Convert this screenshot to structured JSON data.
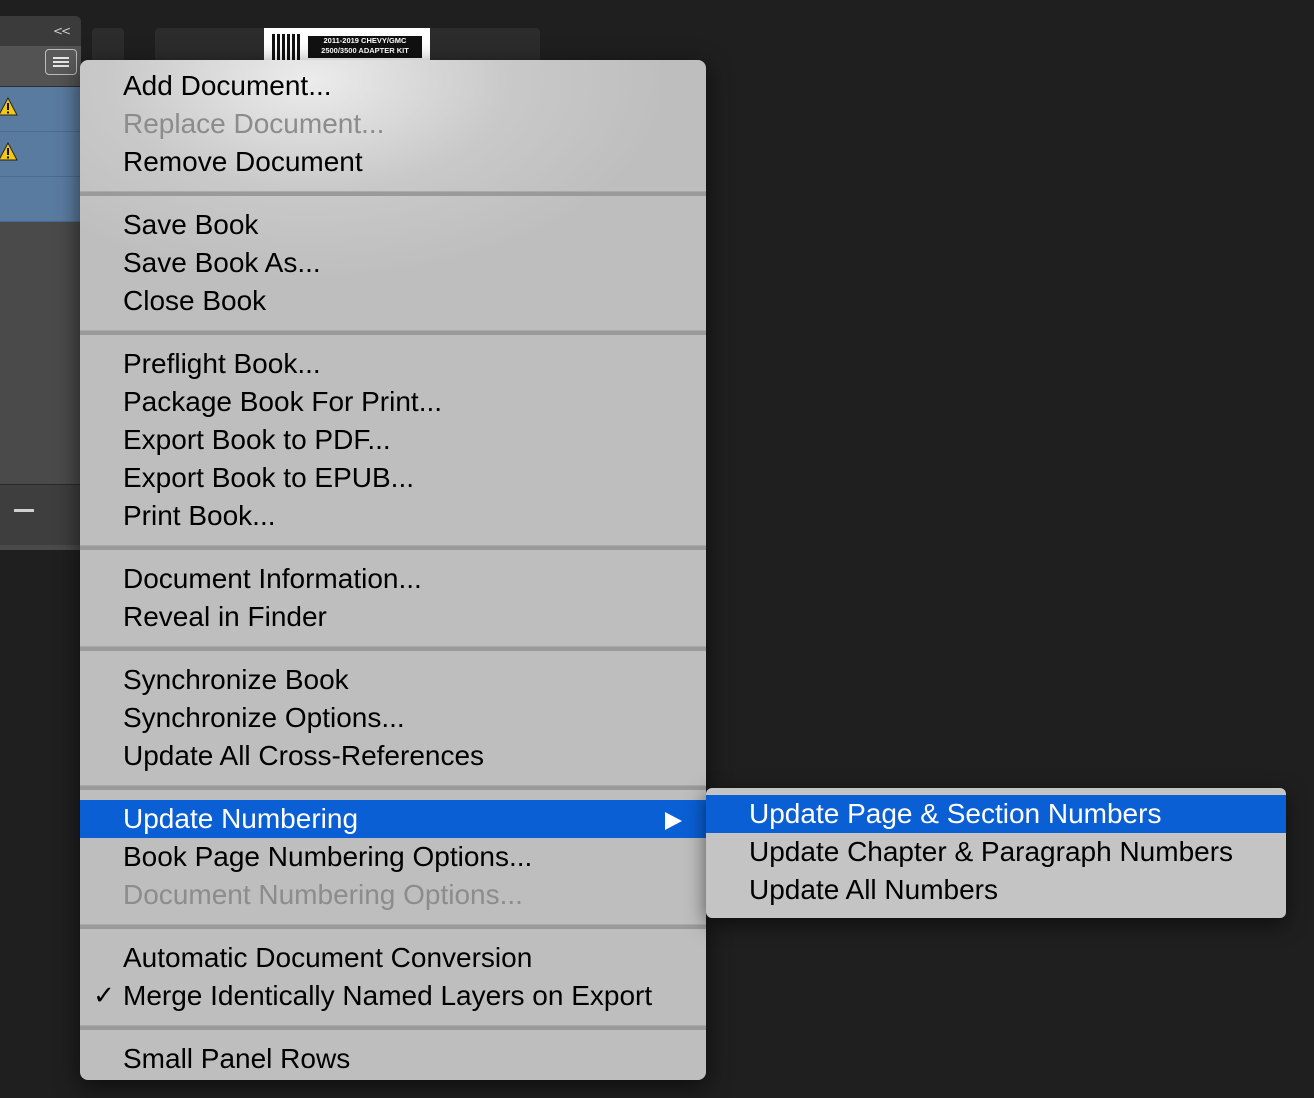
{
  "panel": {
    "collapse_glyph": "<<",
    "documents": [
      {
        "status_icon": "warning-icon"
      },
      {
        "status_icon": "warning-icon"
      },
      {
        "status_icon": ""
      }
    ],
    "colors": {
      "selected_row": "#5a7ba0",
      "panel_bg": "#4a4a4a"
    }
  },
  "thumbnail": {
    "line1": "2011-2019 CHEVY/GMC",
    "line2": "2500/3500 ADAPTER KIT"
  },
  "menu": {
    "groups": [
      [
        {
          "label": "Add Document...",
          "disabled": false
        },
        {
          "label": "Replace Document...",
          "disabled": true
        },
        {
          "label": "Remove Document",
          "disabled": false
        }
      ],
      [
        {
          "label": "Save Book",
          "disabled": false
        },
        {
          "label": "Save Book As...",
          "disabled": false
        },
        {
          "label": "Close Book",
          "disabled": false
        }
      ],
      [
        {
          "label": "Preflight Book...",
          "disabled": false
        },
        {
          "label": "Package Book For Print...",
          "disabled": false
        },
        {
          "label": "Export Book to PDF...",
          "disabled": false
        },
        {
          "label": "Export Book to EPUB...",
          "disabled": false
        },
        {
          "label": "Print Book...",
          "disabled": false
        }
      ],
      [
        {
          "label": "Document Information...",
          "disabled": false
        },
        {
          "label": "Reveal in Finder",
          "disabled": false
        }
      ],
      [
        {
          "label": "Synchronize Book",
          "disabled": false
        },
        {
          "label": "Synchronize Options...",
          "disabled": false
        },
        {
          "label": "Update All Cross-References",
          "disabled": false
        }
      ],
      [
        {
          "label": "Update Numbering",
          "disabled": false,
          "highlighted": true,
          "submenu": true
        },
        {
          "label": "Book Page Numbering Options...",
          "disabled": false
        },
        {
          "label": "Document Numbering Options...",
          "disabled": true
        }
      ],
      [
        {
          "label": "Automatic Document Conversion",
          "disabled": false
        },
        {
          "label": "Merge Identically Named Layers on Export",
          "disabled": false,
          "checked": true,
          "check_glyph": "✓"
        }
      ],
      [
        {
          "label": "Small Panel Rows",
          "disabled": false
        }
      ]
    ]
  },
  "submenu": {
    "items": [
      {
        "label": "Update Page & Section Numbers",
        "highlighted": true
      },
      {
        "label": "Update Chapter & Paragraph Numbers",
        "highlighted": false
      },
      {
        "label": "Update All Numbers",
        "highlighted": false
      }
    ]
  },
  "colors": {
    "highlight": "#0a5fd4",
    "menu_bg": "#bdbdbd",
    "disabled_text": "#8c8c8c",
    "background": "#1f1f1f"
  }
}
